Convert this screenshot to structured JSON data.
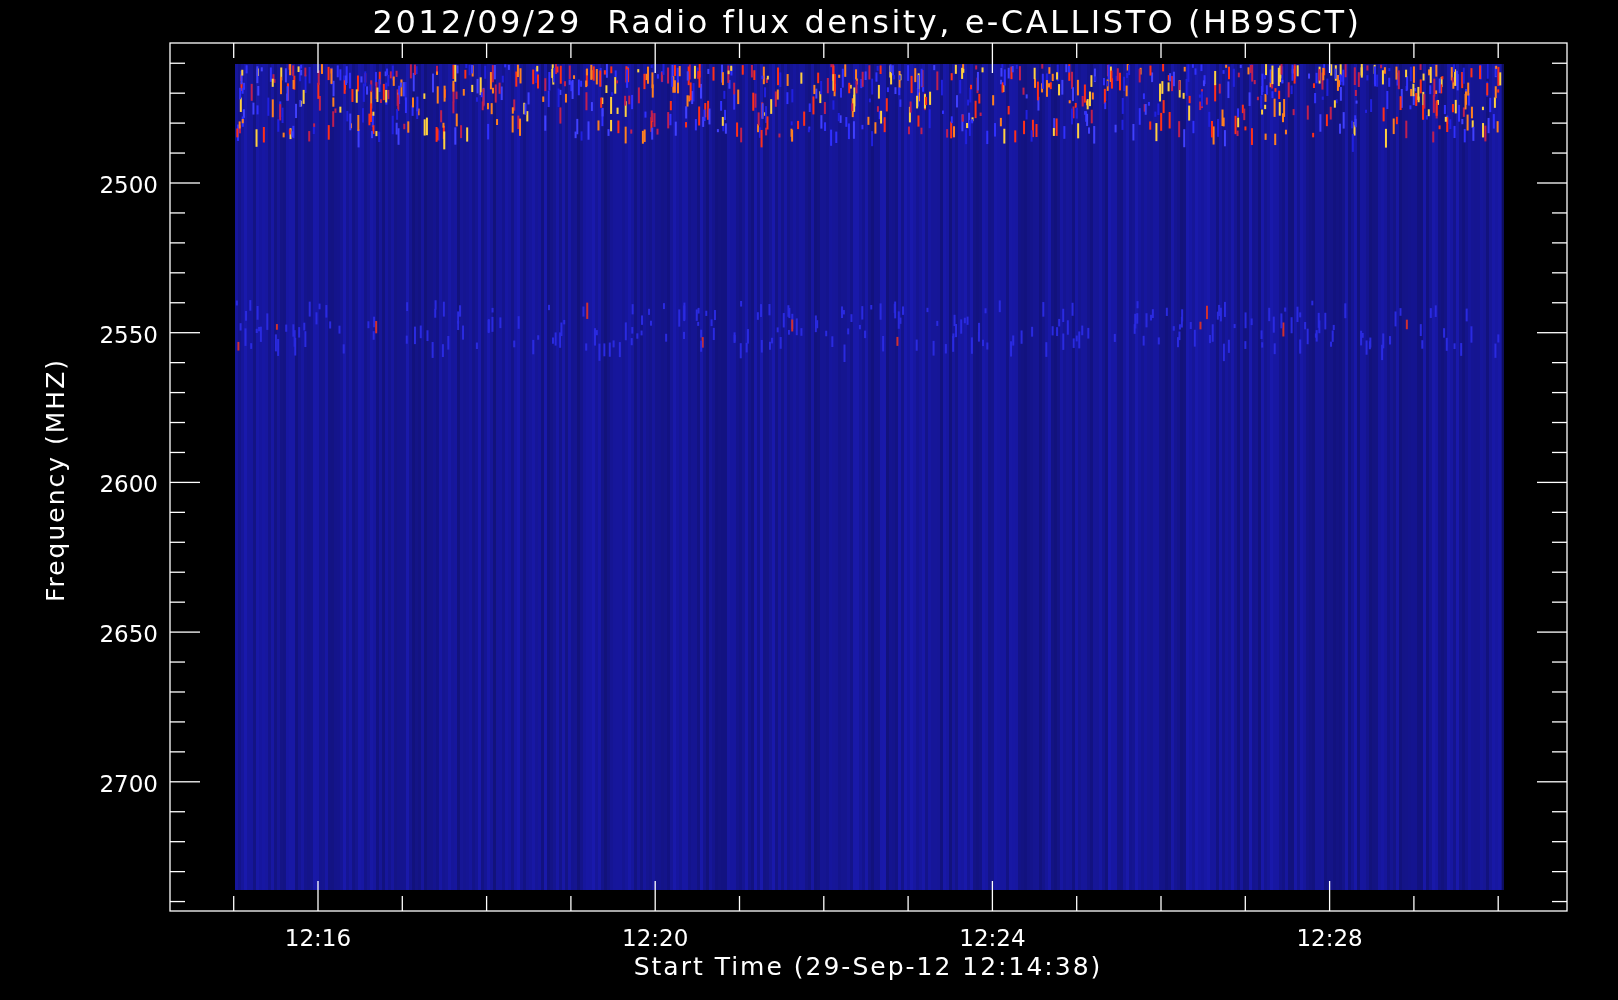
{
  "plot": {
    "title": "2012/09/29  Radio flux density, e-CALLISTO (HB9SCT)",
    "ylabel": "Frequency (MHZ)",
    "xlabel": "Start Time (29-Sep-12 12:14:38)",
    "y_tick_labels": [
      "2500",
      "2550",
      "2600",
      "2650",
      "2700"
    ],
    "x_tick_labels": [
      "12:16",
      "12:20",
      "12:24",
      "12:28"
    ]
  }
}
